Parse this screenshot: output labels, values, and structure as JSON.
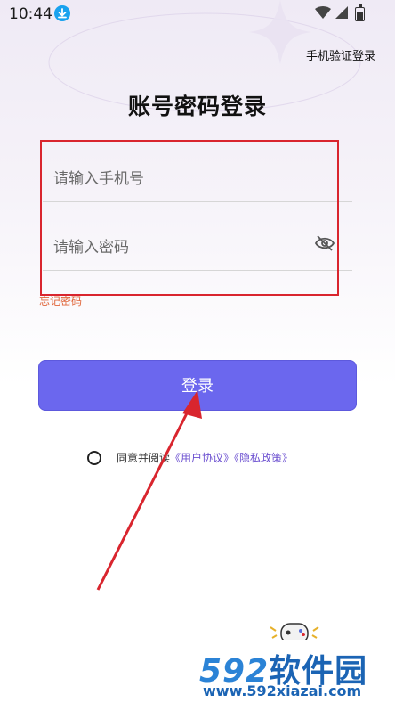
{
  "status_bar": {
    "time": "10:44",
    "icons": [
      "download-icon",
      "wifi-icon",
      "signal-icon",
      "battery-icon"
    ]
  },
  "header": {
    "phone_login_link": "手机验证登录"
  },
  "title": "账号密码登录",
  "form": {
    "phone_placeholder": "请输入手机号",
    "password_placeholder": "请输入密码",
    "forgot_password": "忘记密码"
  },
  "login_button": "登录",
  "agreement": {
    "prefix": "同意并阅读",
    "user_agreement": "《用户协议》",
    "privacy_policy": "《隐私政策》"
  },
  "watermark": {
    "brand_digits": "592",
    "brand_text": "软件园",
    "url": "www.592xiazai.com"
  },
  "colors": {
    "primary": "#6b67ee",
    "annotation_red": "#d9252e",
    "forgot": "#e0663a",
    "link": "#6b4fd0"
  }
}
